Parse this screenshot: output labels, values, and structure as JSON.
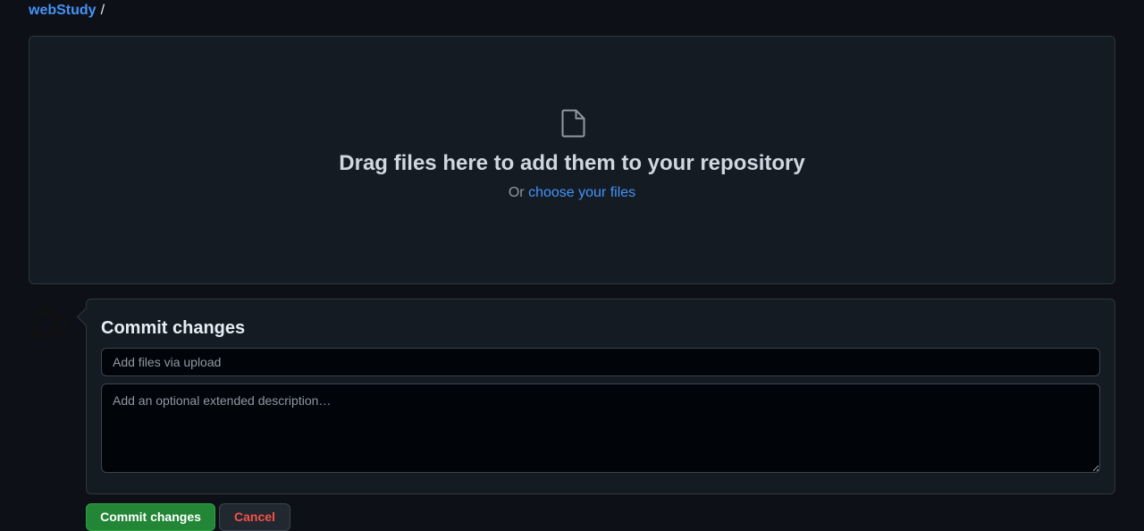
{
  "breadcrumb": {
    "repo": "webStudy",
    "separator": "/"
  },
  "dropzone": {
    "icon": "file-icon",
    "title": "Drag files here to add them to your repository",
    "or_text": "Or",
    "choose_link": "choose your files"
  },
  "commit": {
    "avatar_icon": "teapot-avatar",
    "title": "Commit changes",
    "summary_placeholder": "Add files via upload",
    "summary_value": "",
    "description_placeholder": "Add an optional extended description…",
    "description_value": ""
  },
  "actions": {
    "commit_label": "Commit changes",
    "cancel_label": "Cancel"
  },
  "colors": {
    "background": "#0d1117",
    "link": "#4493f8",
    "primary_button": "#238636",
    "danger_text": "#f85149"
  }
}
